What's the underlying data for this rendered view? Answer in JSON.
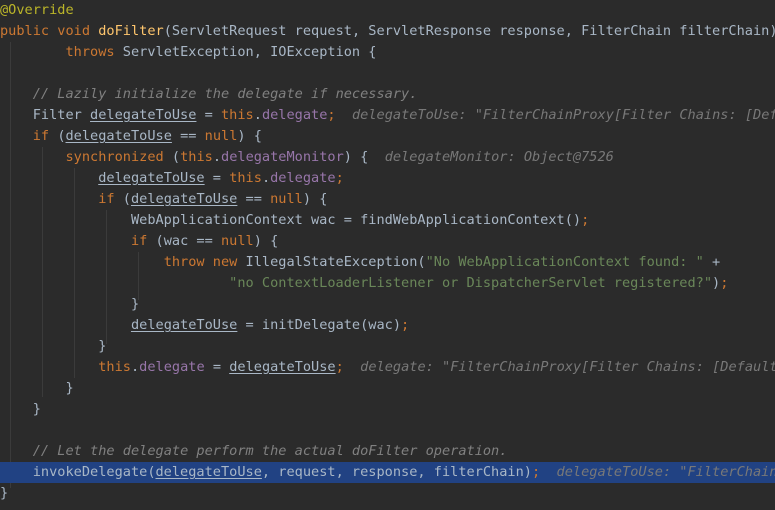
{
  "editor": {
    "language": "Java",
    "highlighted_line": 22,
    "colors": {
      "background": "#2b2b2b",
      "current_line": "#214283",
      "keyword": "#cc7832",
      "method_decl": "#ffc66d",
      "field": "#9876aa",
      "string": "#6a8759",
      "comment": "#808080",
      "annotation": "#bbb529",
      "inline_hint": "#787878"
    },
    "lines": [
      [
        [
          "ann",
          "@Override"
        ]
      ],
      [
        [
          "kw",
          "public void "
        ],
        [
          "fn",
          "doFilter"
        ],
        [
          "plain",
          "(ServletRequest request, ServletResponse response, FilterChain filterChain)"
        ]
      ],
      [
        [
          "plain",
          "        "
        ],
        [
          "kw",
          "throws "
        ],
        [
          "plain",
          "ServletException, IOException {"
        ]
      ],
      [],
      [
        [
          "plain",
          "    "
        ],
        [
          "comment",
          "// Lazily initialize the delegate if necessary."
        ]
      ],
      [
        [
          "plain",
          "    Filter "
        ],
        [
          "ul",
          "delegateToUse"
        ],
        [
          "plain",
          " = "
        ],
        [
          "kw",
          "this"
        ],
        [
          "plain",
          "."
        ],
        [
          "field",
          "delegate"
        ],
        [
          "kw",
          ";"
        ],
        [
          "plain",
          "  "
        ],
        [
          "hint",
          "delegateToUse: \"FilterChainProxy[Filter Chains: [Def"
        ]
      ],
      [
        [
          "plain",
          "    "
        ],
        [
          "kw",
          "if "
        ],
        [
          "plain",
          "("
        ],
        [
          "ul",
          "delegateToUse"
        ],
        [
          "plain",
          " == "
        ],
        [
          "kw",
          "null"
        ],
        [
          "plain",
          ") {"
        ]
      ],
      [
        [
          "plain",
          "        "
        ],
        [
          "kw",
          "synchronized "
        ],
        [
          "plain",
          "("
        ],
        [
          "kw",
          "this"
        ],
        [
          "plain",
          "."
        ],
        [
          "field",
          "delegateMonitor"
        ],
        [
          "plain",
          ") {  "
        ],
        [
          "hint",
          "delegateMonitor: Object@7526"
        ]
      ],
      [
        [
          "plain",
          "            "
        ],
        [
          "ul",
          "delegateToUse"
        ],
        [
          "plain",
          " = "
        ],
        [
          "kw",
          "this"
        ],
        [
          "plain",
          "."
        ],
        [
          "field",
          "delegate"
        ],
        [
          "kw",
          ";"
        ]
      ],
      [
        [
          "plain",
          "            "
        ],
        [
          "kw",
          "if "
        ],
        [
          "plain",
          "("
        ],
        [
          "ul",
          "delegateToUse"
        ],
        [
          "plain",
          " == "
        ],
        [
          "kw",
          "null"
        ],
        [
          "plain",
          ") {"
        ]
      ],
      [
        [
          "plain",
          "                WebApplicationContext wac = findWebApplicationContext()"
        ],
        [
          "kw",
          ";"
        ]
      ],
      [
        [
          "plain",
          "                "
        ],
        [
          "kw",
          "if "
        ],
        [
          "plain",
          "(wac == "
        ],
        [
          "kw",
          "null"
        ],
        [
          "plain",
          ") {"
        ]
      ],
      [
        [
          "plain",
          "                    "
        ],
        [
          "kw",
          "throw new "
        ],
        [
          "plain",
          "IllegalStateException("
        ],
        [
          "str",
          "\"No WebApplicationContext found: \""
        ],
        [
          "plain",
          " +"
        ]
      ],
      [
        [
          "plain",
          "                            "
        ],
        [
          "str",
          "\"no ContextLoaderListener or DispatcherServlet registered?\""
        ],
        [
          "plain",
          ")"
        ],
        [
          "kw",
          ";"
        ]
      ],
      [
        [
          "plain",
          "                }"
        ]
      ],
      [
        [
          "plain",
          "                "
        ],
        [
          "ul",
          "delegateToUse"
        ],
        [
          "plain",
          " = initDelegate(wac)"
        ],
        [
          "kw",
          ";"
        ]
      ],
      [
        [
          "plain",
          "            }"
        ]
      ],
      [
        [
          "plain",
          "            "
        ],
        [
          "kw",
          "this"
        ],
        [
          "plain",
          "."
        ],
        [
          "field",
          "delegate"
        ],
        [
          "plain",
          " = "
        ],
        [
          "ul",
          "delegateToUse"
        ],
        [
          "kw",
          ";"
        ],
        [
          "plain",
          "  "
        ],
        [
          "hint",
          "delegate: \"FilterChainProxy[Filter Chains: [Default"
        ]
      ],
      [
        [
          "plain",
          "        }"
        ]
      ],
      [
        [
          "plain",
          "    }"
        ]
      ],
      [],
      [
        [
          "plain",
          "    "
        ],
        [
          "comment",
          "// Let the delegate perform the actual doFilter operation."
        ]
      ],
      [
        [
          "plain",
          "    invokeDelegate("
        ],
        [
          "ul",
          "delegateToUse"
        ],
        [
          "plain",
          ", request, response, filterChain)"
        ],
        [
          "kw",
          ";"
        ],
        [
          "plain",
          "  "
        ],
        [
          "hint",
          "delegateToUse: \"FilterChain"
        ]
      ],
      [
        [
          "plain",
          "}"
        ]
      ]
    ]
  }
}
